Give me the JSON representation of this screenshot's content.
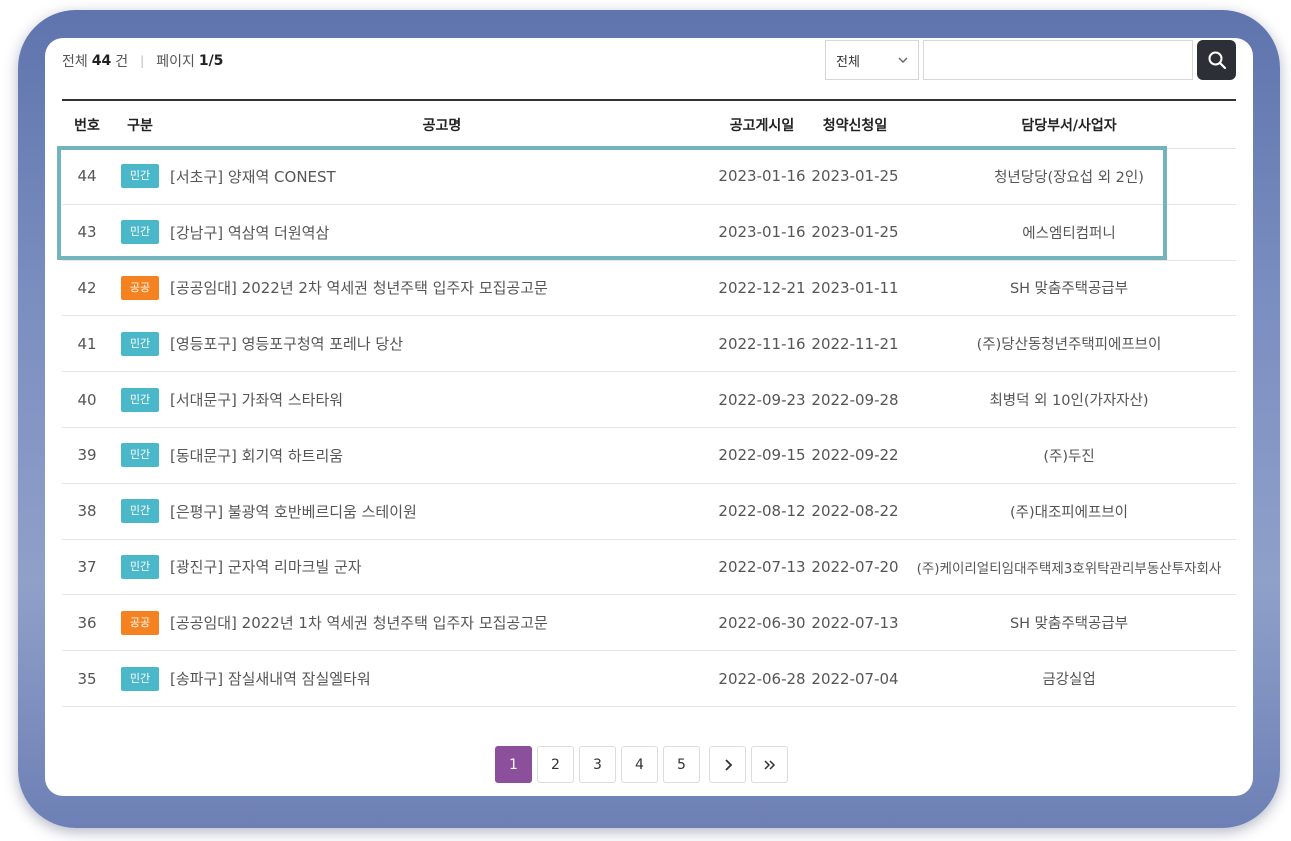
{
  "summary": {
    "total_label": "전체",
    "total_count": "44",
    "total_unit": "건",
    "page_label": "페이지",
    "page_value": "1/5"
  },
  "search": {
    "filter_selected": "전체",
    "placeholder": "",
    "chevron_icon": "chevron-down-icon",
    "button_icon": "search-icon"
  },
  "table": {
    "headers": {
      "no": "번호",
      "type": "구분",
      "title": "공고명",
      "post_date": "공고게시일",
      "apply_date": "청약신청일",
      "dept": "담당부서/사업자"
    },
    "rows": [
      {
        "no": "44",
        "type": "민간",
        "title": "[서초구] 양재역 CONEST",
        "post_date": "2023-01-16",
        "apply_date": "2023-01-25",
        "dept": "청년당당(장요섭 외 2인)"
      },
      {
        "no": "43",
        "type": "민간",
        "title": "[강남구] 역삼역 더원역삼",
        "post_date": "2023-01-16",
        "apply_date": "2023-01-25",
        "dept": "에스엠티컴퍼니"
      },
      {
        "no": "42",
        "type": "공공",
        "title": "[공공임대] 2022년 2차 역세권 청년주택 입주자 모집공고문",
        "post_date": "2022-12-21",
        "apply_date": "2023-01-11",
        "dept": "SH 맞춤주택공급부"
      },
      {
        "no": "41",
        "type": "민간",
        "title": "[영등포구] 영등포구청역 포레나 당산",
        "post_date": "2022-11-16",
        "apply_date": "2022-11-21",
        "dept": "(주)당산동청년주택피에프브이"
      },
      {
        "no": "40",
        "type": "민간",
        "title": "[서대문구] 가좌역 스타타워",
        "post_date": "2022-09-23",
        "apply_date": "2022-09-28",
        "dept": "최병덕 외 10인(가자자산)"
      },
      {
        "no": "39",
        "type": "민간",
        "title": "[동대문구] 회기역 하트리움",
        "post_date": "2022-09-15",
        "apply_date": "2022-09-22",
        "dept": "(주)두진"
      },
      {
        "no": "38",
        "type": "민간",
        "title": "[은평구] 불광역 호반베르디움 스테이원",
        "post_date": "2022-08-12",
        "apply_date": "2022-08-22",
        "dept": "(주)대조피에프브이"
      },
      {
        "no": "37",
        "type": "민간",
        "title": "[광진구] 군자역 리마크빌 군자",
        "post_date": "2022-07-13",
        "apply_date": "2022-07-20",
        "dept": "(주)케이리얼티임대주택제3호위탁관리부동산투자회사"
      },
      {
        "no": "36",
        "type": "공공",
        "title": "[공공임대] 2022년 1차 역세권 청년주택 입주자 모집공고문",
        "post_date": "2022-06-30",
        "apply_date": "2022-07-13",
        "dept": "SH 맞춤주택공급부"
      },
      {
        "no": "35",
        "type": "민간",
        "title": "[송파구] 잠실새내역 잠실엘타워",
        "post_date": "2022-06-28",
        "apply_date": "2022-07-04",
        "dept": "금강실업"
      }
    ]
  },
  "badge_colors": {
    "민간": "#4bb8c9",
    "공공": "#f58220"
  },
  "pagination": {
    "pages": [
      "1",
      "2",
      "3",
      "4",
      "5"
    ],
    "active": "1",
    "next_icon": "chevron-right-icon",
    "last_icon": "double-chevron-right-icon"
  },
  "colors": {
    "highlight_border": "#73b3bb",
    "active_page": "#8c4f9c",
    "search_button": "#2c2f36"
  }
}
